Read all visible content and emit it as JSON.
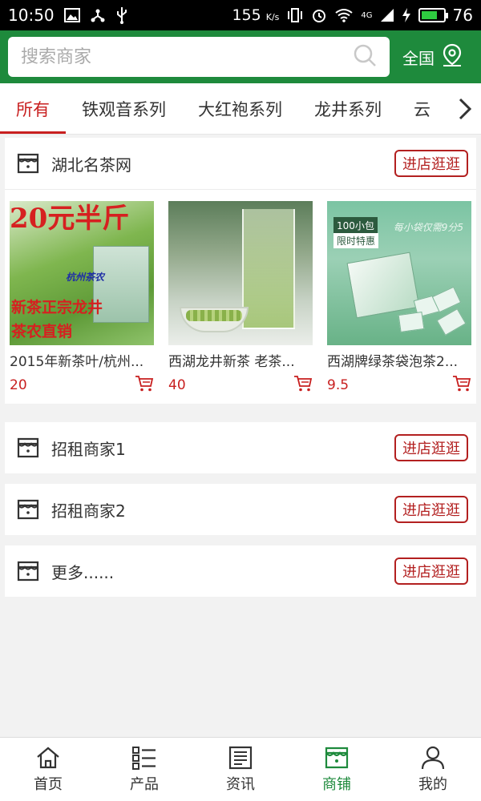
{
  "status_bar": {
    "time": "10:50",
    "net_speed": "155",
    "net_unit": "K/s",
    "network": "4G",
    "battery_percent": "76",
    "battery_level": 0.76
  },
  "search": {
    "placeholder": "搜索商家"
  },
  "region": {
    "label": "全国"
  },
  "tabs": [
    {
      "label": "所有",
      "active": true
    },
    {
      "label": "铁观音系列",
      "active": false
    },
    {
      "label": "大红袍系列",
      "active": false
    },
    {
      "label": "龙井系列",
      "active": false
    },
    {
      "label": "云",
      "active": false
    }
  ],
  "visit_label": "进店逛逛",
  "shops": [
    {
      "name": "湖北名茶网",
      "products": [
        {
          "title": "2015年新茶叶/杭州...",
          "price": "20",
          "image_text": {
            "headline": "20元半斤",
            "line1": "新茶正宗龙井",
            "line2": "茶农直销",
            "brand": "杭州茶农"
          }
        },
        {
          "title": "西湖龙井新茶 老茶...",
          "price": "40"
        },
        {
          "title": "西湖牌绿茶袋泡茶2...",
          "price": "9.5",
          "image_text": {
            "tag": "100小包",
            "tag2": "限时特惠",
            "ad": "每小袋仅需9分5"
          }
        }
      ]
    },
    {
      "name": "招租商家1"
    },
    {
      "name": "招租商家2"
    },
    {
      "name": "更多......"
    }
  ],
  "bottom_nav": [
    {
      "label": "首页",
      "icon": "home-icon",
      "active": false
    },
    {
      "label": "产品",
      "icon": "list-icon",
      "active": false
    },
    {
      "label": "资讯",
      "icon": "news-icon",
      "active": false
    },
    {
      "label": "商铺",
      "icon": "store-icon",
      "active": true
    },
    {
      "label": "我的",
      "icon": "user-icon",
      "active": false
    }
  ],
  "colors": {
    "brand_green": "#1e8a3c",
    "accent_red": "#c81f1f",
    "button_red": "#b32020"
  }
}
